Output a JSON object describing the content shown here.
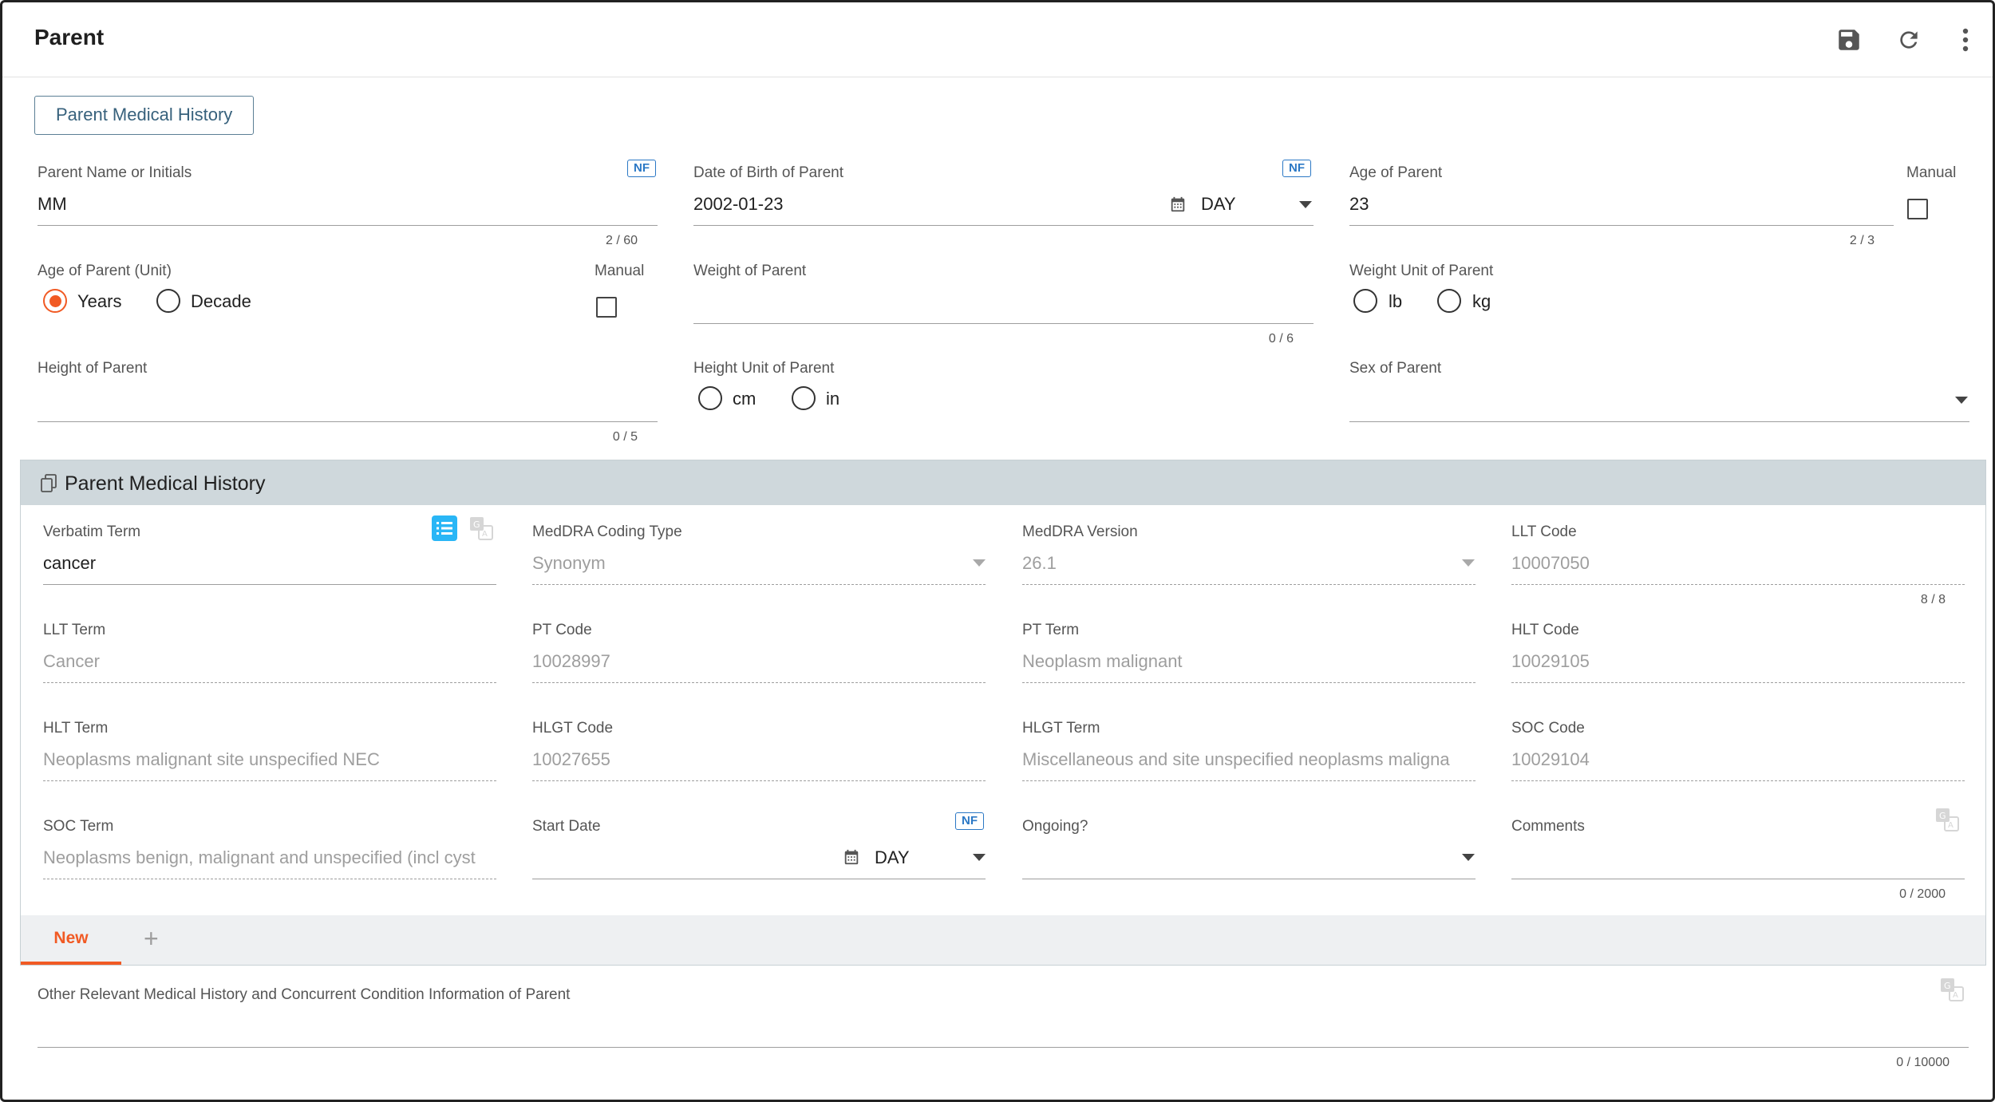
{
  "header": {
    "title": "Parent",
    "icons": [
      "save-icon",
      "refresh-icon",
      "more-vert-icon"
    ]
  },
  "section_button": "Parent Medical History",
  "fields": {
    "parent_name": {
      "label": "Parent Name or Initials",
      "value": "MM",
      "counter": "2 / 60",
      "nf": "NF"
    },
    "dob": {
      "label": "Date of Birth of Parent",
      "value": "2002-01-23",
      "precision": "DAY",
      "nf": "NF"
    },
    "age": {
      "label": "Age of Parent",
      "value": "23",
      "counter": "2 / 3",
      "manual": "Manual"
    },
    "age_unit": {
      "label": "Age of Parent (Unit)",
      "options": [
        "Years",
        "Decade"
      ],
      "selected": "Years",
      "manual": "Manual"
    },
    "weight": {
      "label": "Weight of Parent",
      "value": "",
      "counter": "0 / 6"
    },
    "weight_unit": {
      "label": "Weight Unit of Parent",
      "options": [
        "lb",
        "kg"
      ]
    },
    "height": {
      "label": "Height of Parent",
      "value": "",
      "counter": "0 / 5"
    },
    "height_unit": {
      "label": "Height Unit of Parent",
      "options": [
        "cm",
        "in"
      ]
    },
    "sex": {
      "label": "Sex of Parent",
      "value": ""
    }
  },
  "medical_history": {
    "title": "Parent Medical History",
    "verbatim": {
      "label": "Verbatim Term",
      "value": "cancer"
    },
    "coding_type": {
      "label": "MedDRA Coding Type",
      "value": "Synonym"
    },
    "version": {
      "label": "MedDRA Version",
      "value": "26.1"
    },
    "llt_code": {
      "label": "LLT Code",
      "value": "10007050",
      "counter": "8 / 8"
    },
    "llt_term": {
      "label": "LLT Term",
      "value": "Cancer"
    },
    "pt_code": {
      "label": "PT Code",
      "value": "10028997"
    },
    "pt_term": {
      "label": "PT Term",
      "value": "Neoplasm malignant"
    },
    "hlt_code": {
      "label": "HLT Code",
      "value": "10029105"
    },
    "hlt_term": {
      "label": "HLT Term",
      "value": "Neoplasms malignant site unspecified NEC"
    },
    "hlgt_code": {
      "label": "HLGT Code",
      "value": "10027655"
    },
    "hlgt_term": {
      "label": "HLGT Term",
      "value": "Miscellaneous and site unspecified neoplasms maligna"
    },
    "soc_code": {
      "label": "SOC Code",
      "value": "10029104"
    },
    "soc_term": {
      "label": "SOC Term",
      "value": "Neoplasms benign, malignant and unspecified (incl cyst"
    },
    "start_date": {
      "label": "Start Date",
      "value": "",
      "precision": "DAY",
      "nf": "NF"
    },
    "ongoing": {
      "label": "Ongoing?",
      "value": ""
    },
    "comments": {
      "label": "Comments",
      "value": "",
      "counter": "0 / 2000"
    },
    "tabs": [
      {
        "label": "New",
        "active": true
      }
    ],
    "add_tab": "+"
  },
  "other_history": {
    "label": "Other Relevant Medical History and Concurrent Condition Information of Parent",
    "value": "",
    "counter": "0 / 10000"
  },
  "colors": {
    "accent": "#f15a24",
    "nf_blue": "#2b78c5",
    "section_header": "#cfd8dc",
    "icon_blue": "#29b6f6"
  }
}
